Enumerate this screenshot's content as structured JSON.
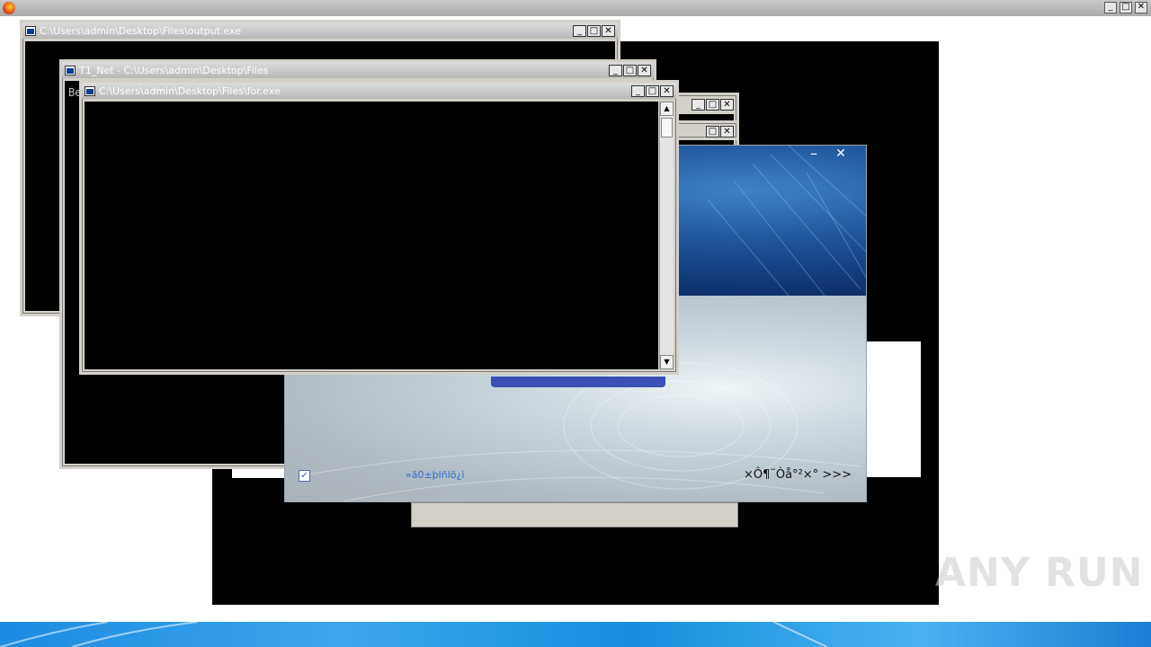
{
  "windows": {
    "output": {
      "title": "C:\\Users\\admin\\Desktop\\Files\\output.exe"
    },
    "t1net": {
      "title": "T1_Net - C:\\Users\\admin\\Desktop\\Files",
      "console_text": "Be"
    },
    "forexe": {
      "title": "C:\\Users\\admin\\Desktop\\Files\\for.exe"
    }
  },
  "installer": {
    "checkbox_label": "»ã0±þlñlõ¿ì",
    "next_link": "×Ô¶¨Òå°²×° >>>",
    "minimize_glyph": "–",
    "close_glyph": "✕"
  },
  "controls": {
    "minimize": "_",
    "maximize": "□",
    "close": "✕"
  },
  "watermark": {
    "text": "ANY RUN"
  },
  "colors": {
    "installer_accent": "#3c4fb4",
    "link_blue": "#2a6dd6",
    "taskbar": "#1d8be0"
  }
}
